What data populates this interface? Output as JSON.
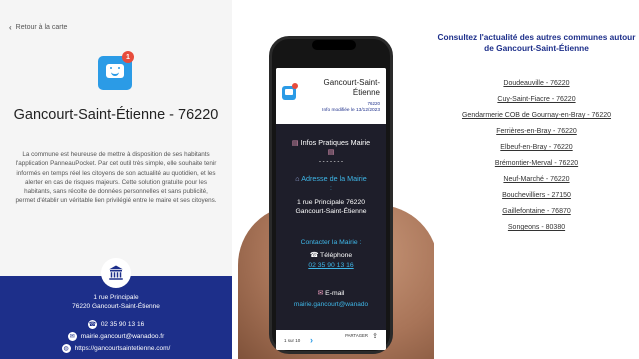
{
  "left": {
    "back_label": "Retour à la carte",
    "notification_count": "1",
    "town_title": "Gancourt-Saint-Étienne - 76220",
    "description": "La commune est heureuse de mettre à disposition de ses habitants l'application PanneauPocket. Par cet outil très simple, elle souhaite tenir informés en temps réel les citoyens de son actualité au quotidien, et les alerter en cas de risques majeurs. Cette solution gratuite pour les habitants, sans récolte de données personnelles et sans publicité, permet d'établir un véritable lien privilégié entre le maire et ses citoyens.",
    "address_line1": "1 rue Principale",
    "address_line2": "76220 Gancourt-Saint-Étienne",
    "phone": "02 35 90 13 16",
    "email": "mairie.gancourt@wanadoo.fr",
    "website": "https://gancourtsaintetienne.com/"
  },
  "phone_screen": {
    "title": "Gancourt-Saint-Étienne",
    "postcode": "76220",
    "modified": "Info modifiée le 13/12/2023",
    "infos_title": "Infos Pratiques Mairie",
    "dashes": "- - - - - - -",
    "address_heading": "Adresse de la Mairie",
    "colon": ":",
    "address": "1 rue Principale 76220 Gancourt-Saint-Étienne",
    "contact_heading": "Contacter la Mairie :",
    "phone_label": "Téléphone",
    "phone": "02 35 90 13 16",
    "email_label": "E-mail",
    "email": "mairie.gancourt@wanado",
    "pager": "1 sur 10",
    "share": "PARTAGER"
  },
  "right": {
    "title": "Consultez l'actualité des autres communes autour de Gancourt-Saint-Étienne",
    "towns": [
      "Doudeauville - 76220",
      "Cuy-Saint-Fiacre - 76220",
      "Gendarmerie COB de Gournay-en-Bray - 76220",
      "Ferrières-en-Bray - 76220",
      "Elbeuf-en-Bray - 76220",
      "Brémontier-Merval - 76220",
      "Neuf-Marché - 76220",
      "Bouchevilliers - 27150",
      "Gaillefontaine - 76870",
      "Songeons - 80380"
    ]
  }
}
